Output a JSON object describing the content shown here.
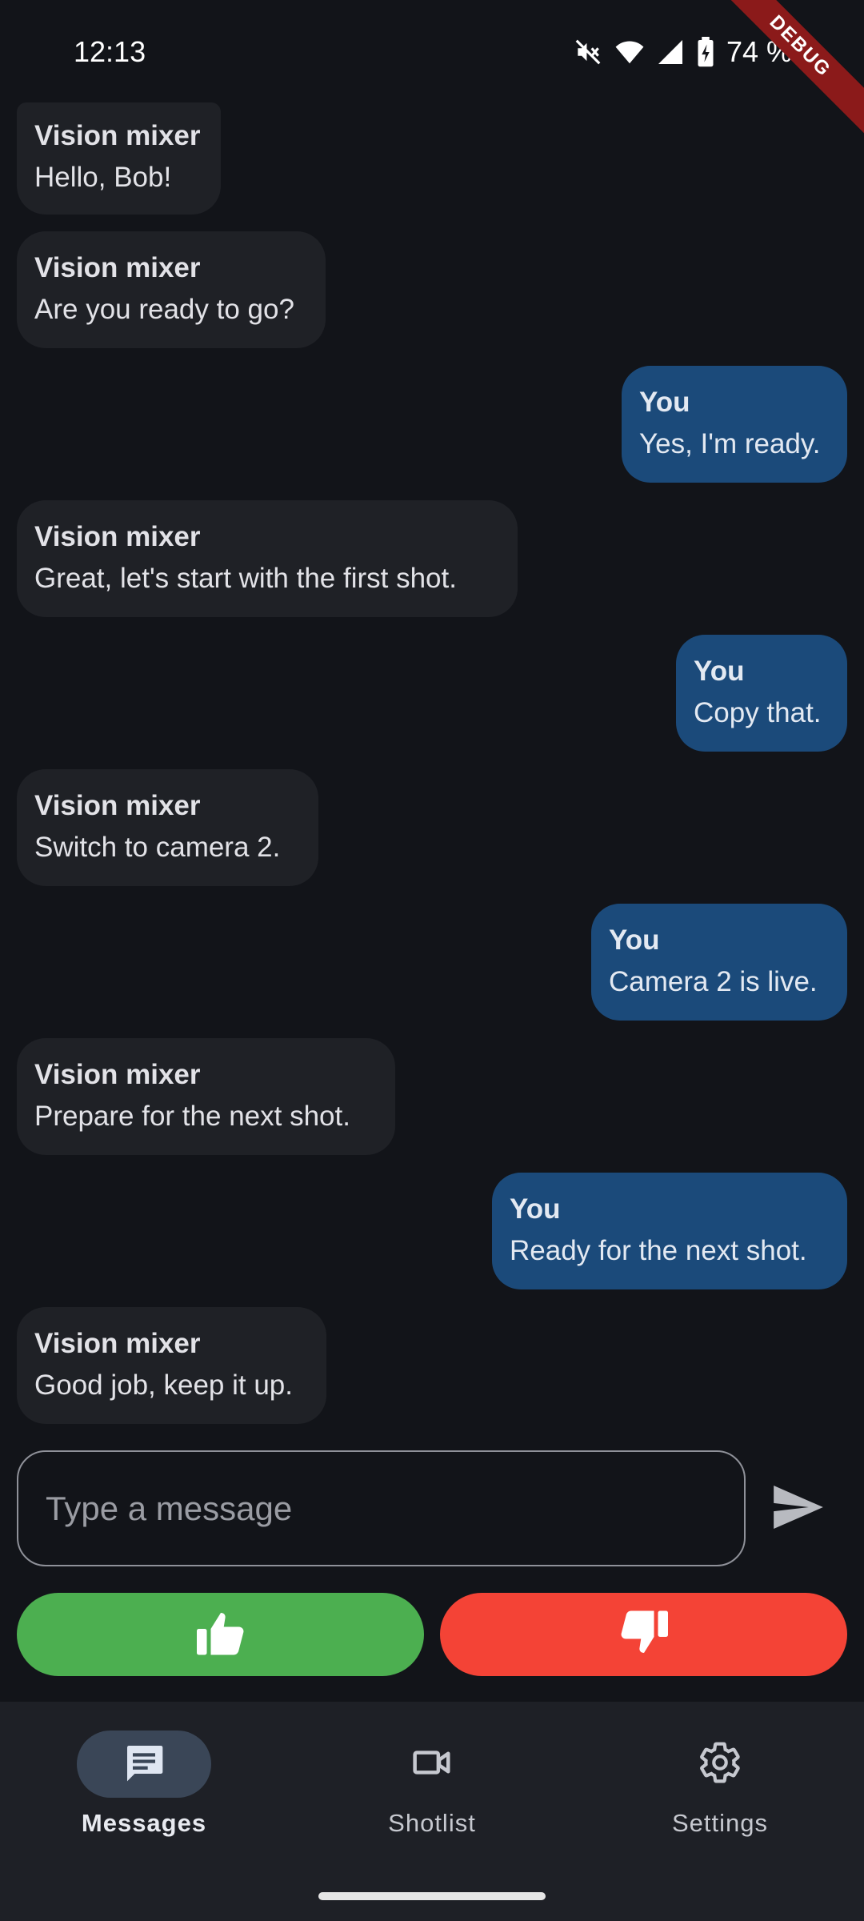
{
  "status_bar": {
    "time": "12:13",
    "battery": "74 %",
    "icons": [
      "mute-icon",
      "wifi-icon",
      "signal-icon",
      "battery-charging-icon"
    ]
  },
  "debug_banner": "DEBUG",
  "messages": [
    {
      "from": "them",
      "sender": "Vision mixer",
      "text": "Hello, Bob!"
    },
    {
      "from": "them",
      "sender": "Vision mixer",
      "text": "Are you ready to go?"
    },
    {
      "from": "you",
      "sender": "You",
      "text": "Yes, I'm ready."
    },
    {
      "from": "them",
      "sender": "Vision mixer",
      "text": "Great, let's start with the first shot."
    },
    {
      "from": "you",
      "sender": "You",
      "text": "Copy that."
    },
    {
      "from": "them",
      "sender": "Vision mixer",
      "text": "Switch to camera 2."
    },
    {
      "from": "you",
      "sender": "You",
      "text": "Camera 2 is live."
    },
    {
      "from": "them",
      "sender": "Vision mixer",
      "text": "Prepare for the next shot."
    },
    {
      "from": "you",
      "sender": "You",
      "text": "Ready for the next shot."
    },
    {
      "from": "them",
      "sender": "Vision mixer",
      "text": "Good job, keep it up."
    }
  ],
  "composer": {
    "placeholder": "Type a message",
    "value": ""
  },
  "reactions": {
    "thumbs_up_icon": "thumbs-up-icon",
    "thumbs_down_icon": "thumbs-down-icon",
    "thumbs_up_color": "#4caf50",
    "thumbs_down_color": "#f44336"
  },
  "bottom_nav": {
    "items": [
      {
        "label": "Messages",
        "icon": "message-icon",
        "active": true
      },
      {
        "label": "Shotlist",
        "icon": "video-camera-icon",
        "active": false
      },
      {
        "label": "Settings",
        "icon": "gear-icon",
        "active": false
      }
    ]
  },
  "colors": {
    "background": "#121419",
    "bubble_them": "#1f2126",
    "bubble_you": "#1b4a7a",
    "nav_background": "#1e2026",
    "nav_active_pill": "#3a4657"
  }
}
